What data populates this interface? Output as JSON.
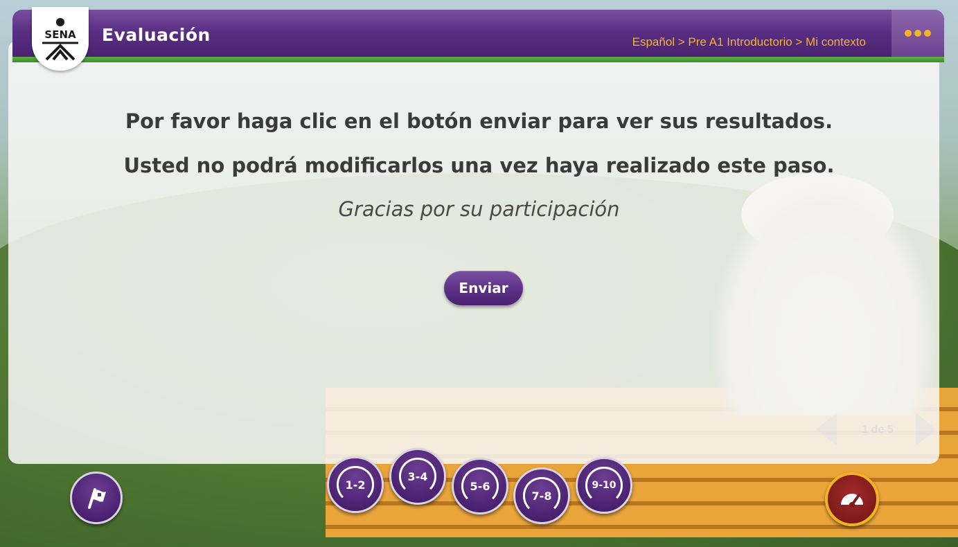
{
  "header": {
    "logo_text": "SENA",
    "title": "Evaluación",
    "breadcrumb": "Español > Pre A1 Introductorio > Mi contexto",
    "menu_icon": "more-dots-icon"
  },
  "main": {
    "line1": "Por favor haga clic en el botón enviar para ver sus resultados.",
    "line2": "Usted no podrá modificarlos una vez haya realizado este paso.",
    "thanks": "Gracias por su participación",
    "send_label": "Enviar"
  },
  "pager": {
    "text": "1 de 5"
  },
  "footer": {
    "section_buttons": [
      "1-2",
      "3-4",
      "5-6",
      "7-8",
      "9-10"
    ],
    "left_icon": "flag-icon",
    "right_icon": "speedometer-icon"
  },
  "colors": {
    "accent_purple": "#5a2f84",
    "accent_gold": "#f5b524",
    "accent_green": "#4fa43a"
  }
}
